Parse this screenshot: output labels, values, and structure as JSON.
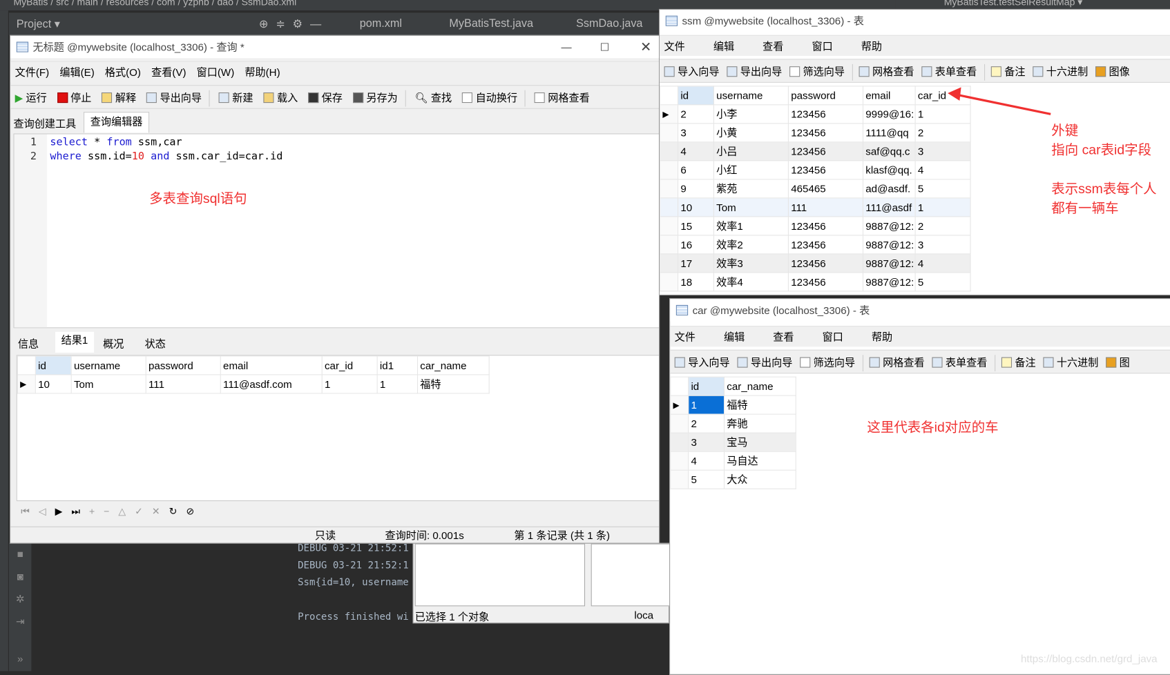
{
  "ide": {
    "breadcrumb": "MyBatis / src / main / resources / com / yzpnb / dao / SsmDao.xml",
    "project_label": "Project ▾",
    "tabs": [
      "pom.xml",
      "MyBatisTest.java",
      "SsmDao.java"
    ],
    "run_config": "MyBatisTest.testSelResultMap ▾",
    "console": [
      "DEBUG 03-21 21:52:1",
      "DEBUG 03-21 21:52:1",
      "Ssm{id=10, username",
      "Process finished wi"
    ]
  },
  "query_window": {
    "title": "无标题 @mywebsite (localhost_3306) - 查询 *",
    "menu": [
      "文件(F)",
      "编辑(E)",
      "格式(O)",
      "查看(V)",
      "窗口(W)",
      "帮助(H)"
    ],
    "toolbar": [
      "运行",
      "停止",
      "解释",
      "导出向导",
      "新建",
      "载入",
      "保存",
      "另存为",
      "查找",
      "自动换行",
      "网格查看"
    ],
    "tabs": [
      "查询创建工具",
      "查询编辑器"
    ],
    "code": {
      "line1": {
        "n": "1",
        "kw1": "select",
        "mid": " * ",
        "kw2": "from",
        "rest": " ssm,car"
      },
      "line2": {
        "n": "2",
        "kw1": "where",
        "mid": " ssm.id=",
        "num": "10",
        "kw2": " and",
        "rest": " ssm.car_id=car.id"
      }
    },
    "annotation": "多表查询sql语句",
    "result_tabs": [
      "信息",
      "结果1",
      "概况",
      "状态"
    ],
    "result_columns": [
      "id",
      "username",
      "password",
      "email",
      "car_id",
      "id1",
      "car_name"
    ],
    "result_rows": [
      [
        "10",
        "Tom",
        "111",
        "111@asdf.com",
        "1",
        "1",
        "福特"
      ]
    ],
    "status": {
      "readonly": "只读",
      "time": "查询时间: 0.001s",
      "record": "第 1 条记录 (共 1 条)"
    }
  },
  "back_window": {
    "status": "已选择 1 个对象",
    "conn": "loca"
  },
  "ssm_window": {
    "title": "ssm @mywebsite (localhost_3306) - 表",
    "menu": [
      "文件",
      "编辑",
      "查看",
      "窗口",
      "帮助"
    ],
    "toolbar": [
      "导入向导",
      "导出向导",
      "筛选向导",
      "网格查看",
      "表单查看",
      "备注",
      "十六进制",
      "图像"
    ],
    "columns": [
      "id",
      "username",
      "password",
      "email",
      "car_id"
    ],
    "rows": [
      [
        "2",
        "小李",
        "123456",
        "9999@16:",
        "1"
      ],
      [
        "3",
        "小黄",
        "123456",
        "1111@qq",
        "2"
      ],
      [
        "4",
        "小吕",
        "123456",
        "saf@qq.c",
        "3"
      ],
      [
        "6",
        "小红",
        "123456",
        "klasf@qq.",
        "4"
      ],
      [
        "9",
        "紫苑",
        "465465",
        "ad@asdf.",
        "5"
      ],
      [
        "10",
        "Tom",
        "111",
        "111@asdf",
        "1"
      ],
      [
        "15",
        "效率1",
        "123456",
        "9887@12:",
        "2"
      ],
      [
        "16",
        "效率2",
        "123456",
        "9887@12:",
        "3"
      ],
      [
        "17",
        "效率3",
        "123456",
        "9887@12:",
        "4"
      ],
      [
        "18",
        "效率4",
        "123456",
        "9887@12:",
        "5"
      ]
    ],
    "annotation": {
      "line1": "外键",
      "line2": "指向 car表id字段",
      "line3": "表示ssm表每个人",
      "line4": "都有一辆车"
    }
  },
  "car_window": {
    "title": "car @mywebsite (localhost_3306) - 表",
    "menu": [
      "文件",
      "编辑",
      "查看",
      "窗口",
      "帮助"
    ],
    "toolbar": [
      "导入向导",
      "导出向导",
      "筛选向导",
      "网格查看",
      "表单查看",
      "备注",
      "十六进制",
      "图"
    ],
    "columns": [
      "id",
      "car_name"
    ],
    "rows": [
      [
        "1",
        "福特"
      ],
      [
        "2",
        "奔驰"
      ],
      [
        "3",
        "宝马"
      ],
      [
        "4",
        "马自达"
      ],
      [
        "5",
        "大众"
      ]
    ],
    "annotation": "这里代表各id对应的车"
  },
  "watermark": "https://blog.csdn.net/grd_java",
  "colors": {
    "annotation": "#f03030",
    "selection": "#0a6fd6",
    "ide_bg": "#2b2b2b"
  }
}
